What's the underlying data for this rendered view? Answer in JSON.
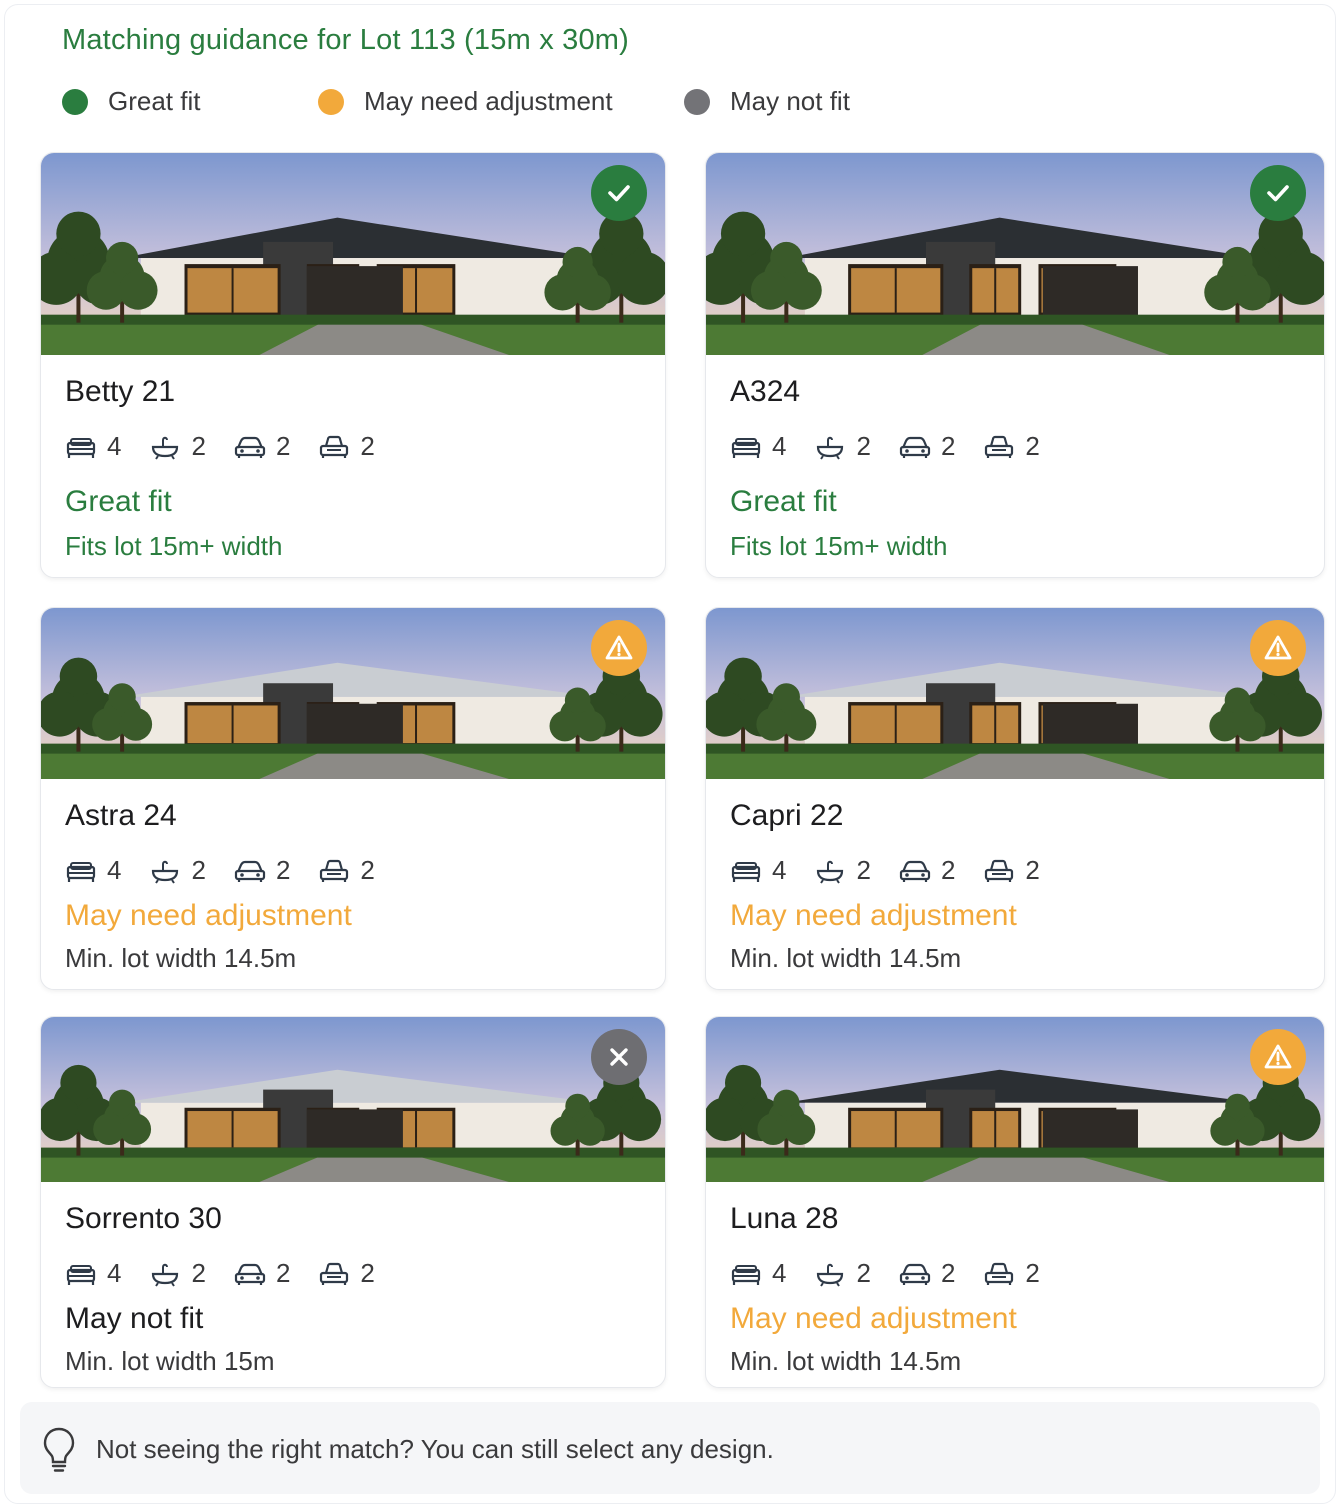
{
  "header": {
    "title": "Matching guidance for Lot 113 (15m x 30m)"
  },
  "legend": [
    {
      "label": "Great fit",
      "color": "#2a7d3f"
    },
    {
      "label": "May need adjustment",
      "color": "#f2a93b"
    },
    {
      "label": "May not fit",
      "color": "#737377"
    }
  ],
  "designs": [
    {
      "name": "Betty 21",
      "beds": "4",
      "baths": "2",
      "garage": "2",
      "living": "2",
      "status": "Great fit",
      "detail": "Fits lot 15m+ width",
      "fit": "great",
      "badge_icon": "check-icon"
    },
    {
      "name": "A324",
      "beds": "4",
      "baths": "2",
      "garage": "2",
      "living": "2",
      "status": "Great fit",
      "detail": "Fits lot 15m+ width",
      "fit": "great",
      "badge_icon": "check-icon"
    },
    {
      "name": "Astra 24",
      "beds": "4",
      "baths": "2",
      "garage": "2",
      "living": "2",
      "status": "May need adjustment",
      "detail": "Min. lot width 14.5m",
      "fit": "adjust",
      "badge_icon": "warning-icon"
    },
    {
      "name": "Capri 22",
      "beds": "4",
      "baths": "2",
      "garage": "2",
      "living": "2",
      "status": "May need adjustment",
      "detail": "Min. lot width 14.5m",
      "fit": "adjust",
      "badge_icon": "warning-icon"
    },
    {
      "name": "Sorrento 30",
      "beds": "4",
      "baths": "2",
      "garage": "2",
      "living": "2",
      "status": "May not fit",
      "detail": "Min. lot width 15m",
      "fit": "nofit",
      "badge_icon": "close-icon"
    },
    {
      "name": "Luna 28",
      "beds": "4",
      "baths": "2",
      "garage": "2",
      "living": "2",
      "status": "May need adjustment",
      "detail": "Min. lot width 14.5m",
      "fit": "adjust",
      "badge_icon": "warning-icon"
    }
  ],
  "colors": {
    "great": "#2a7d3f",
    "adjust": "#f2a93b",
    "nofit_badge": "#6e6e72",
    "nofit_text": "#1d1d1f",
    "detail_neutral": "#3a3a3c"
  },
  "tip": {
    "text": "Not seeing the right match? You can still select any design.",
    "icon": "lightbulb-icon"
  }
}
